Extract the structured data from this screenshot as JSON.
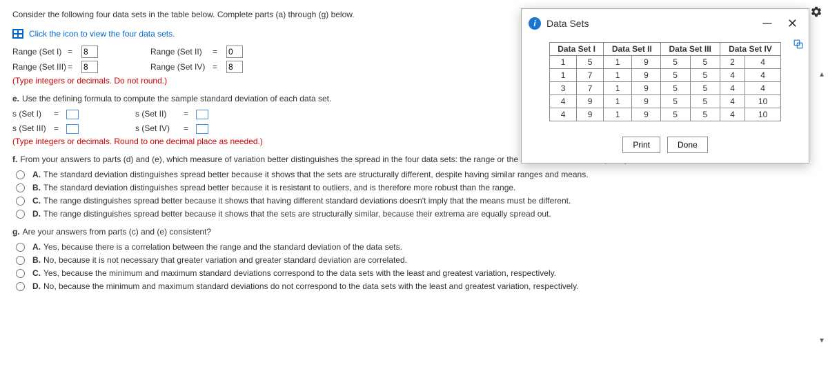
{
  "intro": "Consider the following four data sets in the table below. Complete parts (a) through (g) below.",
  "view_link": "Click the icon to view the four data sets.",
  "ranges": {
    "r1_label": "Range (Set I)",
    "r1_val": "8",
    "r2_label": "Range (Set II)",
    "r2_val": "0",
    "r3_label": "Range (Set III)",
    "r3_val": "8",
    "r4_label": "Range (Set IV)",
    "r4_val": "8"
  },
  "range_note": "(Type integers or decimals. Do not round.)",
  "part_e": "Use the defining formula to compute the sample standard deviation of each data set.",
  "sd": {
    "s1": "s (Set I)",
    "s2": "s (Set II)",
    "s3": "s (Set III)",
    "s4": "s (Set IV)"
  },
  "sd_note": "(Type integers or decimals. Round to one decimal place as needed.)",
  "part_f": "From your answers to parts (d) and (e), which measure of variation better distinguishes the spread in the four data sets: the range or the standard deviation? Explain your answer.",
  "f_options": {
    "a": "The standard deviation distinguishes spread better because it shows that the sets are structurally different, despite having similar ranges and means.",
    "b": "The standard deviation distinguishes spread better because it is resistant to outliers, and is therefore more robust than the range.",
    "c": "The range distinguishes spread better because it shows that having different standard deviations doesn't imply that the means must be different.",
    "d": "The range distinguishes spread better because it shows that the sets are structurally similar, because their extrema are equally spread out."
  },
  "part_g": "Are your answers from parts (c) and (e) consistent?",
  "g_options": {
    "a": "Yes, because there is a correlation between the range and the standard deviation of the data sets.",
    "b": "No, because it is not necessary that greater variation and greater standard deviation are correlated.",
    "c": "Yes, because the minimum and maximum standard deviations correspond to the data sets with the least and greatest variation, respectively.",
    "d": "No, because the minimum and maximum standard deviations do not correspond to the data sets with the least and greatest variation, respectively."
  },
  "modal": {
    "title": "Data Sets",
    "headers": [
      "Data Set I",
      "Data Set II",
      "Data Set III",
      "Data Set IV"
    ],
    "rows": [
      [
        "1",
        "5",
        "1",
        "9",
        "5",
        "5",
        "2",
        "4"
      ],
      [
        "1",
        "7",
        "1",
        "9",
        "5",
        "5",
        "4",
        "4"
      ],
      [
        "3",
        "7",
        "1",
        "9",
        "5",
        "5",
        "4",
        "4"
      ],
      [
        "4",
        "9",
        "1",
        "9",
        "5",
        "5",
        "4",
        "10"
      ],
      [
        "4",
        "9",
        "1",
        "9",
        "5",
        "5",
        "4",
        "10"
      ]
    ],
    "print": "Print",
    "done": "Done"
  },
  "eq": "="
}
